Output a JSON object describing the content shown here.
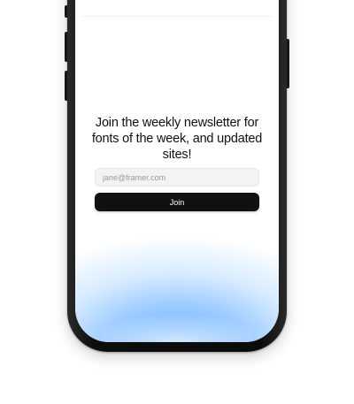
{
  "newsletter": {
    "headline": "Join the weekly newsletter for fonts of the week, and updated sites!",
    "email_placeholder": "jane@framer.com",
    "email_value": "",
    "join_label": "Join"
  },
  "colors": {
    "button": "#111112",
    "accent_glow": "#6fb3ff",
    "field_bg": "#f3f3f4"
  }
}
